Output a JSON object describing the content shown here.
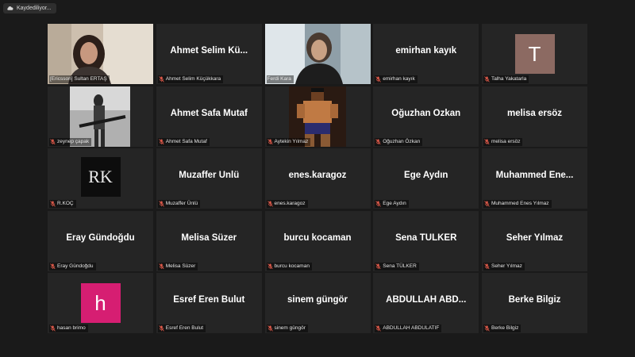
{
  "recording": {
    "label": "Kaydediliyor..."
  },
  "colors": {
    "speaking": "#c5e06a",
    "mic_muted": "#e05a4a",
    "letter_T": "#8c6a62",
    "letter_h": "#d61e72"
  },
  "tiles": [
    {
      "name": "",
      "label": "[Ericsson] Sultan ERTAŞ",
      "type": "video-woman"
    },
    {
      "name": "Ahmet Selim Kü...",
      "label": "Ahmet Selim Küçükkara",
      "type": "name"
    },
    {
      "name": "",
      "label": "Ferdi Kara",
      "type": "video-man",
      "speaking": true
    },
    {
      "name": "emirhan kayık",
      "label": "emirhan kayık",
      "type": "name"
    },
    {
      "name": "",
      "label": "Talha Yakatarla",
      "type": "letter",
      "letter": "T"
    },
    {
      "name": "",
      "label": "zeynep çapak",
      "type": "photo-guitar"
    },
    {
      "name": "Ahmet Safa Mutaf",
      "label": "Ahmet Safa Mutaf",
      "type": "name"
    },
    {
      "name": "",
      "label": "Aytekin Yılmaz",
      "type": "photo-pixel"
    },
    {
      "name": "Oğuzhan Özkan",
      "label": "Oğuzhan Özkan",
      "type": "name"
    },
    {
      "name": "melisa ersöz",
      "label": "melisa ersöz",
      "type": "name"
    },
    {
      "name": "",
      "label": "R.KOÇ",
      "type": "logo-rk",
      "logo": "RK"
    },
    {
      "name": "Muzaffer Ünlü",
      "label": "Muzaffer Ünlü",
      "type": "name"
    },
    {
      "name": "enes.karagoz",
      "label": "enes.karagoz",
      "type": "name"
    },
    {
      "name": "Ege Aydın",
      "label": "Ege Aydın",
      "type": "name"
    },
    {
      "name": "Muhammed Ene...",
      "label": "Muhammed Enes Yılmaz",
      "type": "name"
    },
    {
      "name": "Eray Gündoğdu",
      "label": "Eray Gündoğdu",
      "type": "name"
    },
    {
      "name": "Melisa Süzer",
      "label": "Melisa Süzer",
      "type": "name"
    },
    {
      "name": "burcu kocaman",
      "label": "burcu kocaman",
      "type": "name"
    },
    {
      "name": "Sena TÜLKER",
      "label": "Sena TÜLKER",
      "type": "name"
    },
    {
      "name": "Seher Yılmaz",
      "label": "Seher Yılmaz",
      "type": "name"
    },
    {
      "name": "",
      "label": "hasan brimo",
      "type": "letter",
      "letter": "h"
    },
    {
      "name": "Esref Eren Bulut",
      "label": "Esref Eren Bulut",
      "type": "name"
    },
    {
      "name": "sinem güngör",
      "label": "sinem güngör",
      "type": "name"
    },
    {
      "name": "ABDULLAH ABD...",
      "label": "ABDULLAH ABDULATIF",
      "type": "name"
    },
    {
      "name": "Berke Bilgiz",
      "label": "Berke Bilgiz",
      "type": "name"
    }
  ]
}
